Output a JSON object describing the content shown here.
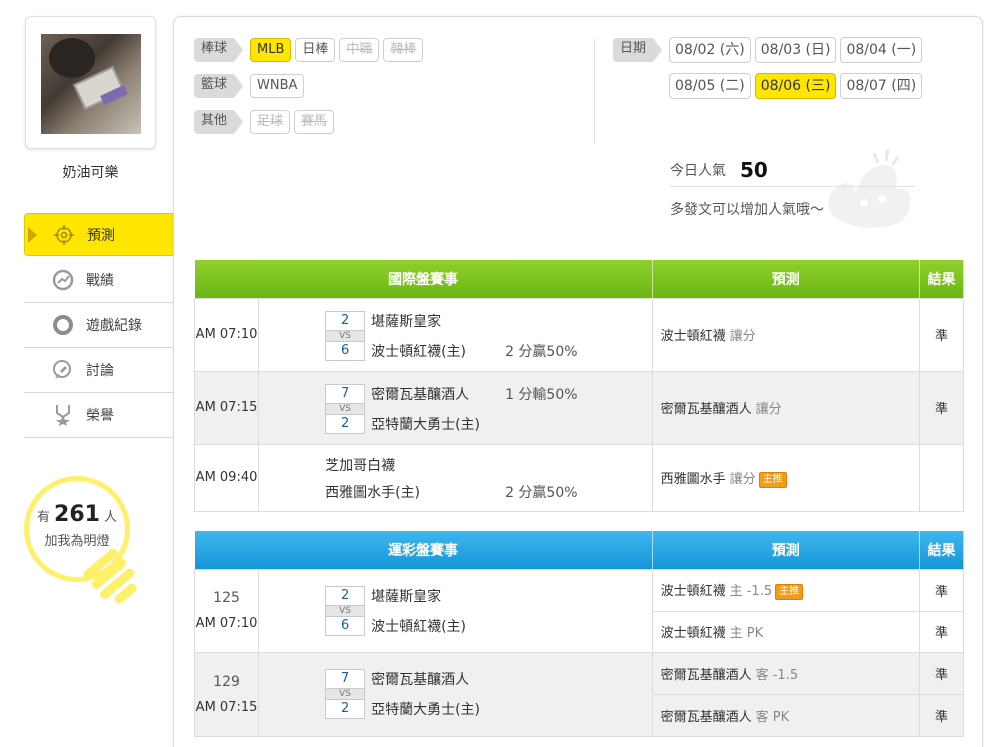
{
  "user": {
    "name": "奶油可樂"
  },
  "nav": [
    {
      "label": "預測",
      "icon": "target-icon",
      "active": true
    },
    {
      "label": "戰績",
      "icon": "chart-icon",
      "active": false
    },
    {
      "label": "遊戲紀錄",
      "icon": "record-icon",
      "active": false
    },
    {
      "label": "討論",
      "icon": "discuss-icon",
      "active": false
    },
    {
      "label": "榮譽",
      "icon": "honor-icon",
      "active": false
    }
  ],
  "fans": {
    "prefix": "有",
    "count": "261",
    "suffix": "人",
    "line2": "加我為明燈"
  },
  "filters": {
    "baseball": {
      "label": "棒球",
      "items": [
        {
          "label": "MLB",
          "state": "on"
        },
        {
          "label": "日棒",
          "state": "normal"
        },
        {
          "label": "中職",
          "state": "off"
        },
        {
          "label": "韓棒",
          "state": "off"
        }
      ]
    },
    "basketball": {
      "label": "籃球",
      "items": [
        {
          "label": "WNBA",
          "state": "normal"
        }
      ]
    },
    "other": {
      "label": "其他",
      "items": [
        {
          "label": "足球",
          "state": "off"
        },
        {
          "label": "賽馬",
          "state": "off"
        }
      ]
    }
  },
  "dates": {
    "label": "日期",
    "items": [
      "08/02 (六)",
      "08/03 (日)",
      "08/04 (一)",
      "08/05 (二)",
      "08/06 (三)",
      "08/07 (四)"
    ],
    "selected": "08/06 (三)"
  },
  "popularity": {
    "label": "今日人氣",
    "value": "50",
    "hint": "多發文可以增加人氣哦～"
  },
  "intl_table": {
    "headers": {
      "event": "國際盤賽事",
      "prediction": "預測",
      "result": "結果"
    },
    "rows": [
      {
        "time": "AM 07:10",
        "away": "堪薩斯皇家",
        "home": "波士頓紅襪(主)",
        "away_score": "2",
        "home_score": "6",
        "vs": "VS",
        "odds": "2 分贏50%",
        "odds_row": "home",
        "pred_team": "波士頓紅襪",
        "pred_type": "讓分",
        "badge": "",
        "result": "準"
      },
      {
        "time": "AM 07:15",
        "away": "密爾瓦基釀酒人",
        "home": "亞特蘭大勇士(主)",
        "away_score": "7",
        "home_score": "2",
        "vs": "VS",
        "odds": "1 分輸50%",
        "odds_row": "away",
        "pred_team": "密爾瓦基釀酒人",
        "pred_type": "讓分",
        "badge": "",
        "result": "準"
      },
      {
        "time": "AM 09:40",
        "away": "芝加哥白襪",
        "home": "西雅圖水手(主)",
        "away_score": "",
        "home_score": "",
        "vs": "",
        "odds": "2 分贏50%",
        "odds_row": "home",
        "pred_team": "西雅圖水手",
        "pred_type": "讓分",
        "badge": "主推",
        "result": ""
      }
    ]
  },
  "sports_table": {
    "headers": {
      "event": "運彩盤賽事",
      "prediction": "預測",
      "result": "結果"
    },
    "rows": [
      {
        "num": "125",
        "time": "AM 07:10",
        "away": "堪薩斯皇家",
        "home": "波士頓紅襪(主)",
        "away_score": "2",
        "home_score": "6",
        "vs": "VS",
        "preds": [
          {
            "team": "波士頓紅襪",
            "type": "主 -1.5",
            "badge": "主推",
            "result": "準"
          },
          {
            "team": "波士頓紅襪",
            "type": "主 PK",
            "badge": "",
            "result": "準"
          }
        ]
      },
      {
        "num": "129",
        "time": "AM 07:15",
        "away": "密爾瓦基釀酒人",
        "home": "亞特蘭大勇士(主)",
        "away_score": "7",
        "home_score": "2",
        "vs": "VS",
        "preds": [
          {
            "team": "密爾瓦基釀酒人",
            "type": "客 -1.5",
            "badge": "",
            "result": "準"
          },
          {
            "team": "密爾瓦基釀酒人",
            "type": "客 PK",
            "badge": "",
            "result": "準"
          }
        ]
      }
    ]
  },
  "colors": {
    "accent_yellow": "#ffe600",
    "intl_header": "#7cc41f",
    "sports_header": "#23a6e3",
    "result_green": "#2b8a2b",
    "badge_orange": "#f39b1a"
  }
}
